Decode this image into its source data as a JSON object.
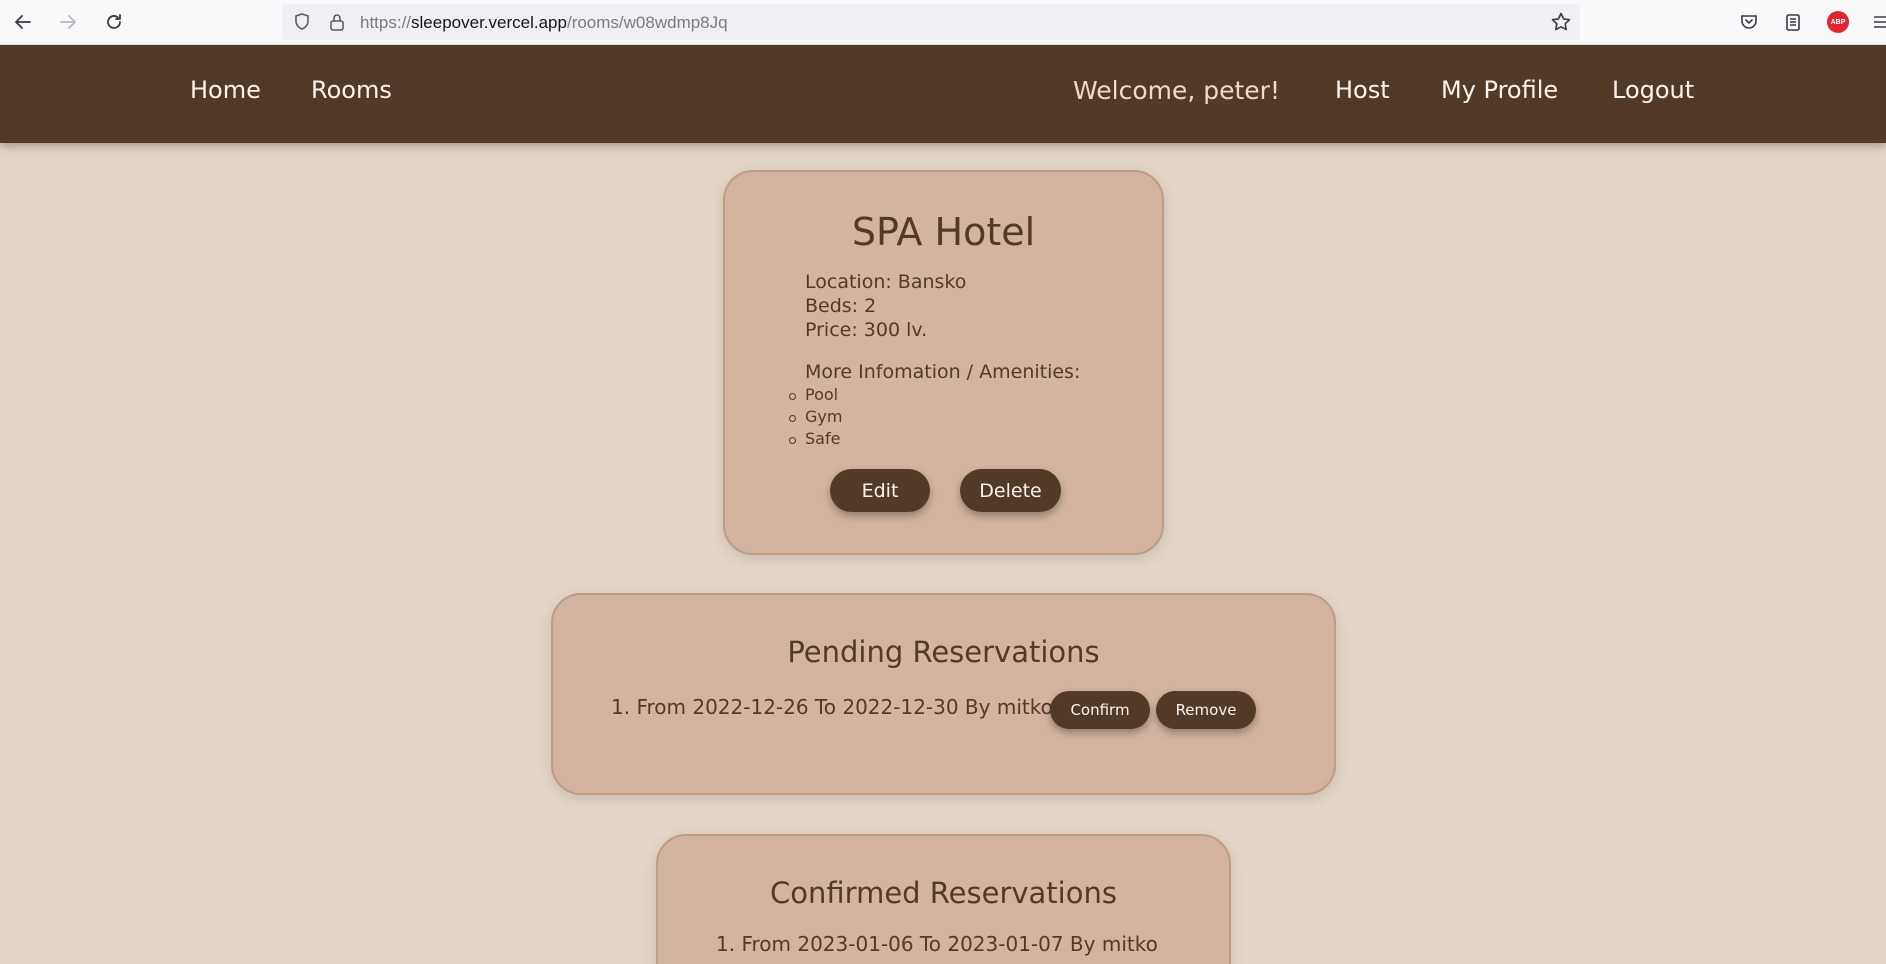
{
  "browser": {
    "url_host_prefix": "https://",
    "url_host": "sleepover.vercel.app",
    "url_path": "/rooms/w08wdmp8Jq"
  },
  "nav": {
    "home": "Home",
    "rooms": "Rooms",
    "welcome": "Welcome, peter!",
    "host": "Host",
    "my_profile": "My Profile",
    "logout": "Logout"
  },
  "room": {
    "title": "SPA Hotel",
    "location": "Location: Bansko",
    "beds": "Beds: 2",
    "price": "Price: 300 lv.",
    "amenities_heading": "More Infomation / Amenities:",
    "amenities": [
      "Pool",
      "Gym",
      "Safe"
    ],
    "edit_label": "Edit",
    "delete_label": "Delete"
  },
  "pending": {
    "title": "Pending Reservations",
    "items": [
      {
        "text": "1. From 2022-12-26 To 2022-12-30 By mitko",
        "confirm_label": "Confirm",
        "remove_label": "Remove"
      }
    ]
  },
  "confirmed": {
    "title": "Confirmed Reservations",
    "items": [
      {
        "text": "1. From 2023-01-06 To 2023-01-07 By mitko"
      }
    ]
  },
  "colors": {
    "header_bg": "#523a29",
    "page_bg": "#e3d5c8",
    "card_bg": "#d2b4a0",
    "button_bg": "#523a29"
  },
  "icons": [
    "back-arrow-icon",
    "forward-arrow-icon",
    "reload-icon",
    "shield-icon",
    "lock-icon",
    "bookmark-star-icon",
    "pocket-icon",
    "reader-icon",
    "adblock-icon",
    "menu-icon"
  ]
}
